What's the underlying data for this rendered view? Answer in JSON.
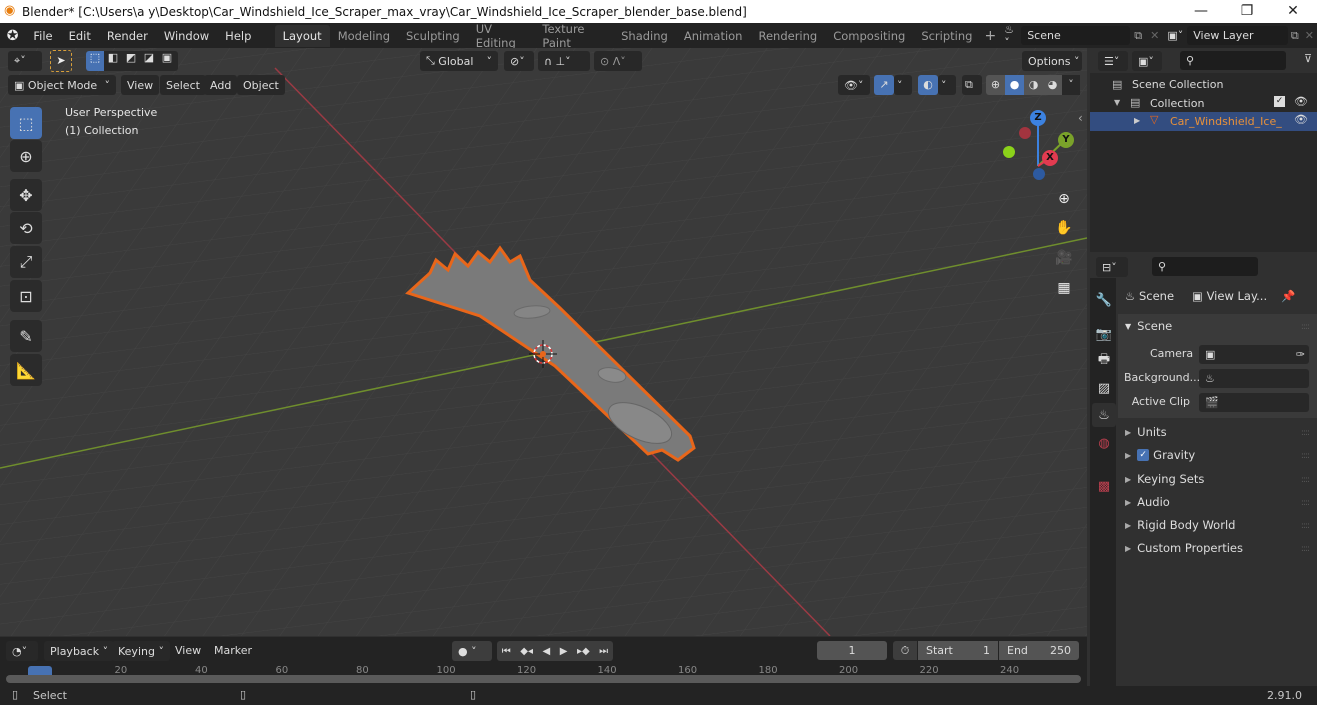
{
  "window": {
    "title": "Blender* [C:\\Users\\a y\\Desktop\\Car_Windshield_Ice_Scraper_max_vray\\Car_Windshield_Ice_Scraper_blender_base.blend]",
    "minimize": "—",
    "restore": "❐",
    "close": "✕"
  },
  "menu": [
    "File",
    "Edit",
    "Render",
    "Window",
    "Help"
  ],
  "workspaces": [
    "Layout",
    "Modeling",
    "Sculpting",
    "UV Editing",
    "Texture Paint",
    "Shading",
    "Animation",
    "Rendering",
    "Compositing",
    "Scripting"
  ],
  "active_workspace": "Layout",
  "add_workspace": "+",
  "scene_field": "Scene",
  "viewlayer_field": "View Layer",
  "viewport": {
    "transform_orientation": "Global",
    "options_label": "Options",
    "mode": "Object Mode",
    "header_menus": [
      "View",
      "Select",
      "Add",
      "Object"
    ],
    "overlay_title": "User Perspective",
    "overlay_collection": "(1) Collection",
    "gizmo": {
      "z": "Z",
      "y": "Y",
      "x": "X"
    }
  },
  "outliner": {
    "search_placeholder": "",
    "items": [
      {
        "label": "Scene Collection",
        "icon": "scene-collection-icon"
      },
      {
        "label": "Collection",
        "icon": "collection-icon",
        "checked": true,
        "visible": true
      },
      {
        "label": "Car_Windshield_Ice_",
        "icon": "mesh-object-icon",
        "selected": true,
        "visible": true
      }
    ]
  },
  "properties": {
    "search_placeholder": "",
    "breadcrumb": [
      "Scene",
      "View Lay..."
    ],
    "section_title": "Scene",
    "fields": [
      {
        "label": "Camera",
        "value": ""
      },
      {
        "label": "Background...",
        "value": ""
      },
      {
        "label": "Active Clip",
        "value": ""
      }
    ],
    "panels": [
      {
        "label": "Units"
      },
      {
        "label": "Gravity",
        "checkbox": true
      },
      {
        "label": "Keying Sets"
      },
      {
        "label": "Audio"
      },
      {
        "label": "Rigid Body World"
      },
      {
        "label": "Custom Properties"
      }
    ]
  },
  "timeline": {
    "menus": [
      "Playback",
      "Keying",
      "View",
      "Marker"
    ],
    "current_frame": "1",
    "start_label": "Start",
    "start": "1",
    "end_label": "End",
    "end": "250",
    "ruler": [
      "1",
      "20",
      "40",
      "60",
      "80",
      "100",
      "120",
      "140",
      "160",
      "180",
      "200",
      "220",
      "240"
    ]
  },
  "status": {
    "left": "Select",
    "version": "2.91.0"
  }
}
